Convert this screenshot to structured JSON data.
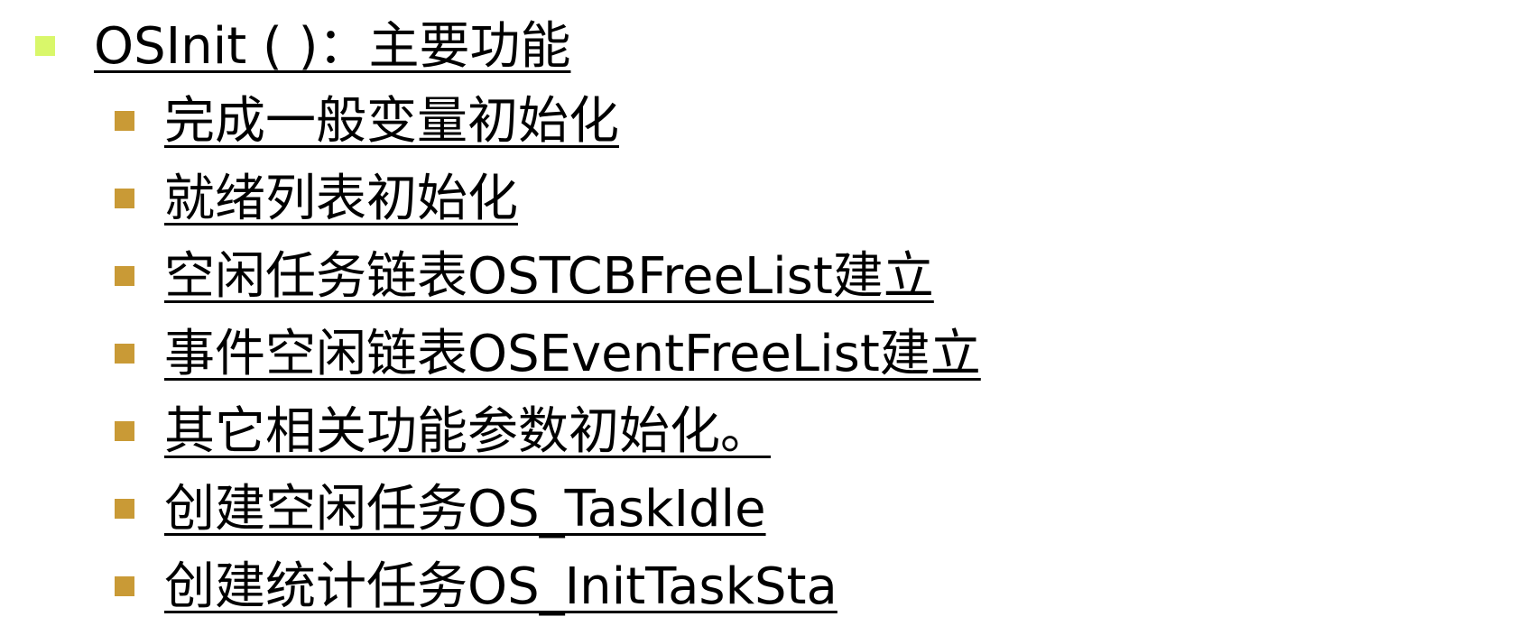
{
  "colors": {
    "bullet_level1": "#d9f76a",
    "bullet_level2": "#c99a36",
    "text": "#000000"
  },
  "heading": {
    "text": "OSInit ( )：主要功能"
  },
  "items": [
    {
      "text": "完成一般变量初始化"
    },
    {
      "text": "就绪列表初始化"
    },
    {
      "text": "空闲任务链表OSTCBFreeList建立"
    },
    {
      "text": "事件空闲链表OSEventFreeList建立"
    },
    {
      "text": "其它相关功能参数初始化。"
    },
    {
      "text": "创建空闲任务OS_TaskIdle"
    },
    {
      "text": "创建统计任务OS_InitTaskSta"
    }
  ]
}
